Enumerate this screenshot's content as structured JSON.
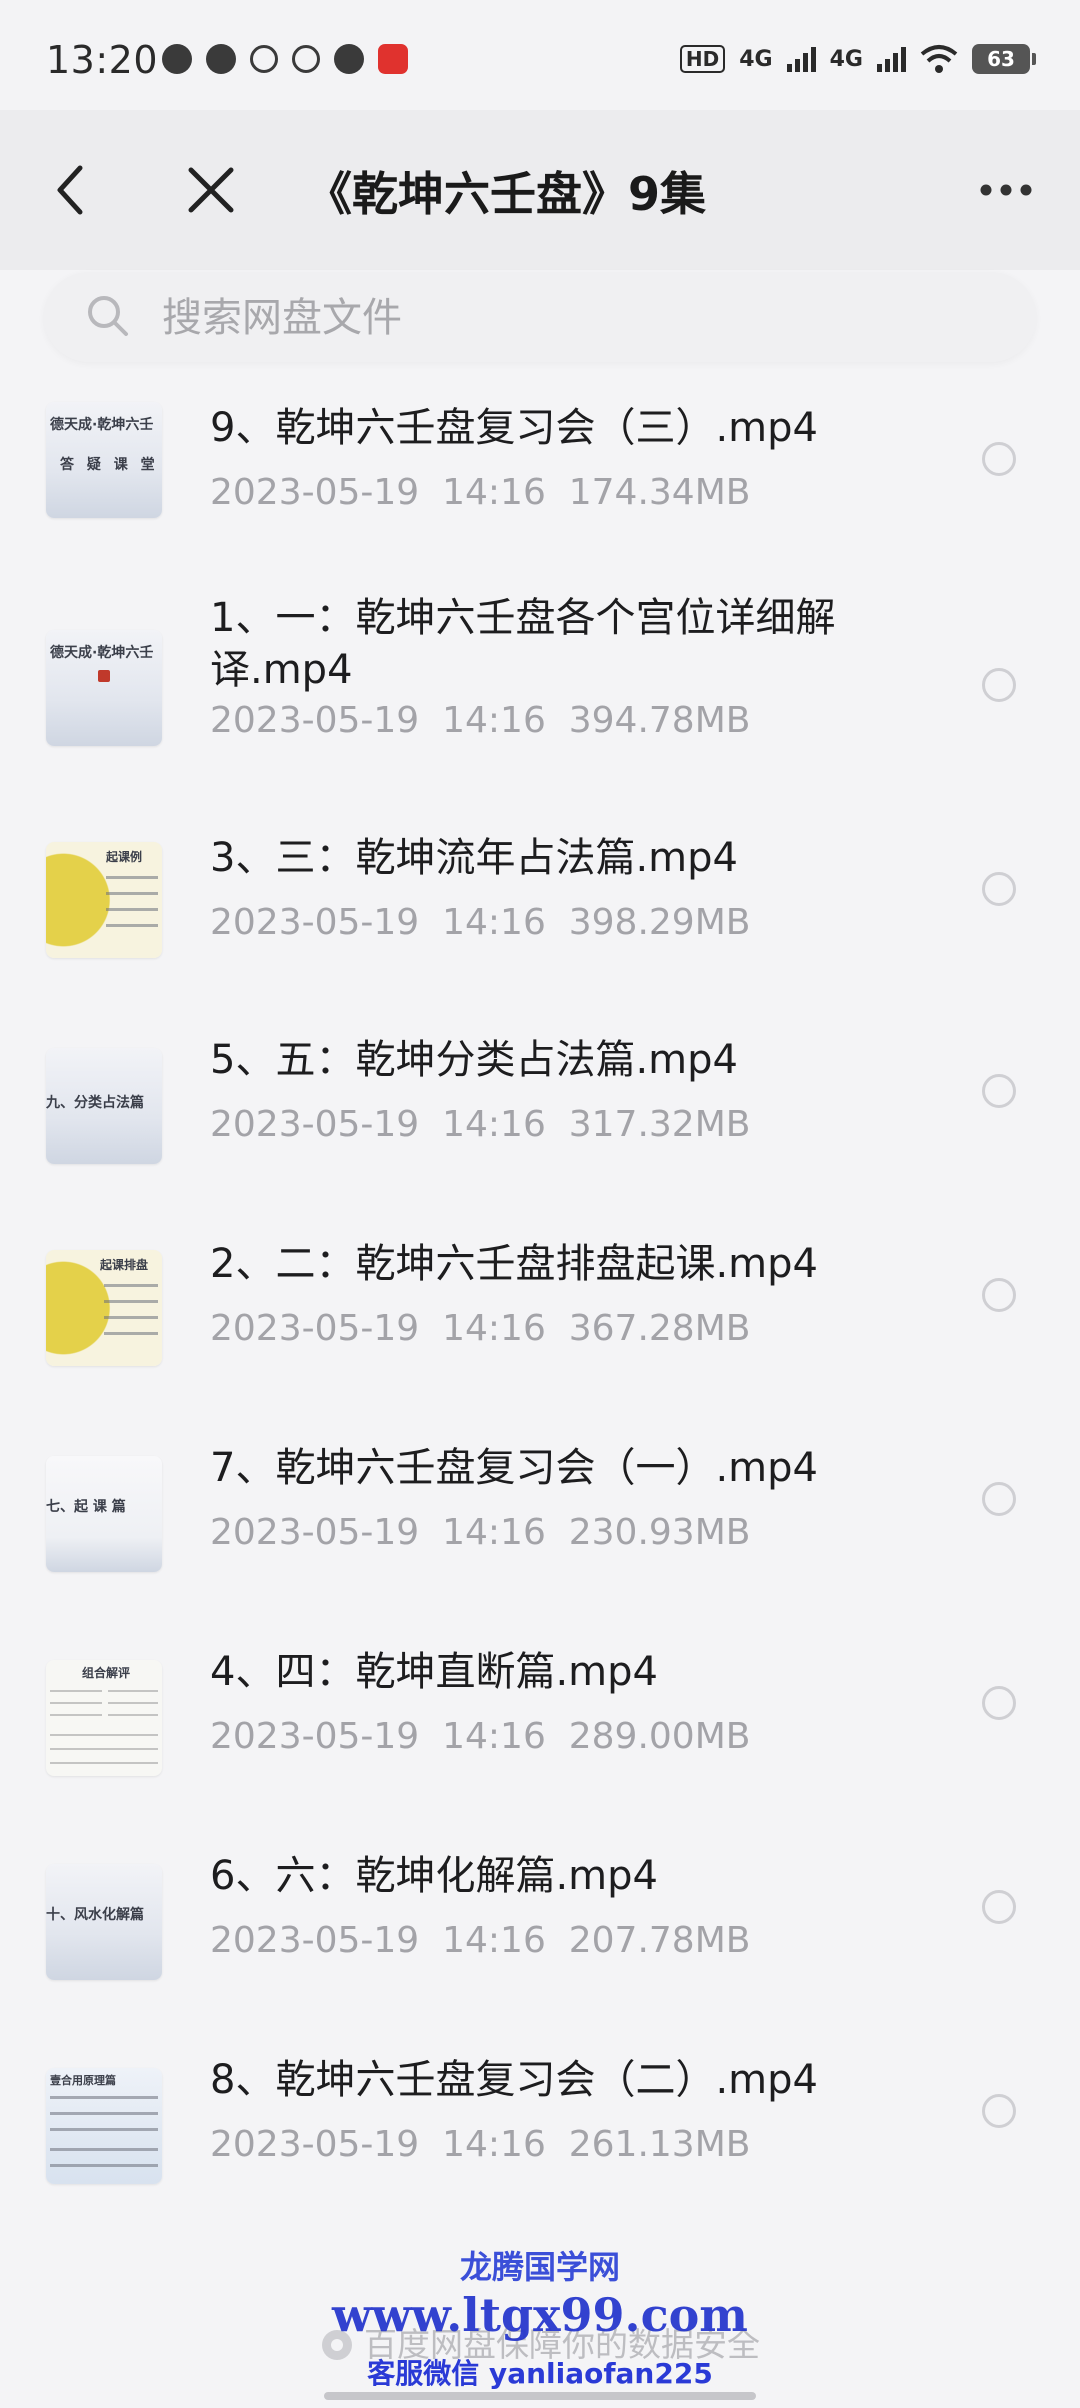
{
  "status_bar": {
    "time": "13:20",
    "hd": "HD",
    "net1": "4G",
    "net2": "4G",
    "battery": "63"
  },
  "nav": {
    "title": "《乾坤六壬盘》9集"
  },
  "search": {
    "placeholder": "搜索网盘文件"
  },
  "files": [
    {
      "name": "9、乾坤六壬盘复习会（三）.mp4",
      "date": "2023-05-19",
      "time": "14:16",
      "size": "174.34MB"
    },
    {
      "name": "1、一：乾坤六壬盘各个宫位详细解译.mp4",
      "date": "2023-05-19",
      "time": "14:16",
      "size": "394.78MB"
    },
    {
      "name": "3、三：乾坤流年占法篇.mp4",
      "date": "2023-05-19",
      "time": "14:16",
      "size": "398.29MB"
    },
    {
      "name": "5、五：乾坤分类占法篇.mp4",
      "date": "2023-05-19",
      "time": "14:16",
      "size": "317.32MB"
    },
    {
      "name": "2、二：乾坤六壬盘排盘起课.mp4",
      "date": "2023-05-19",
      "time": "14:16",
      "size": "367.28MB"
    },
    {
      "name": "7、乾坤六壬盘复习会（一）.mp4",
      "date": "2023-05-19",
      "time": "14:16",
      "size": "230.93MB"
    },
    {
      "name": "4、四：乾坤直断篇.mp4",
      "date": "2023-05-19",
      "time": "14:16",
      "size": "289.00MB"
    },
    {
      "name": "6、六：乾坤化解篇.mp4",
      "date": "2023-05-19",
      "time": "14:16",
      "size": "207.78MB"
    },
    {
      "name": "8、乾坤六壬盘复习会（二）.mp4",
      "date": "2023-05-19",
      "time": "14:16",
      "size": "261.13MB"
    }
  ],
  "thumb_captions": {
    "t0": "德天成·乾坤六壬",
    "t0b": "答 疑 课 堂",
    "t1": "德天成·乾坤六壬",
    "t2": "起课例",
    "t3": "九、分类占法篇",
    "t4": "起课排盘",
    "t5": "七、起 课 篇",
    "t6": "组合解评",
    "t7": "十、风水化解篇",
    "t8": "壹合用原理篇"
  },
  "footer": {
    "secure_text": "百度网盘保障你的数据安全"
  },
  "watermark": {
    "line1": "龙腾国学网",
    "line2": "www.ltgx99.com",
    "line3": "客服微信 yanliaofan225"
  },
  "colors": {
    "background": "#f4f4f6",
    "title": "#1a1a1a",
    "meta": "#a3a3a8",
    "watermark": "#2233cc"
  }
}
